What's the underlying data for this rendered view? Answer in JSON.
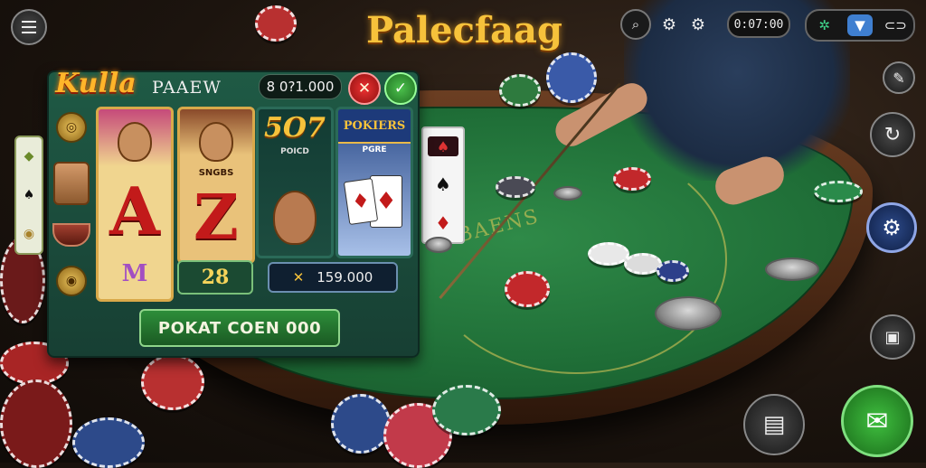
{
  "app": {
    "title": "Palecfaag"
  },
  "hud": {
    "menu_icon": "hamburger-icon",
    "timer": "0:07:00",
    "icons": [
      "search-icon",
      "gear-icon",
      "settings-icon"
    ],
    "right_group": [
      "network-icon",
      "filter-icon",
      "link-icon"
    ],
    "accent_gold": "#f6c23b"
  },
  "slot_panel": {
    "logo_text": "Kulla",
    "game_name": "PAAEW",
    "balance": "8 0?1.000",
    "close_symbol": "✕",
    "confirm_symbol": "✓",
    "reels": [
      {
        "top_label": "",
        "glyph": "A",
        "bottom_label": "M"
      },
      {
        "top_label": "SNGBS",
        "glyph": "Z",
        "bottom_label": ""
      },
      {
        "top_label": "5O7",
        "sub_label": "POICD",
        "glyph": "",
        "bottom_label": ""
      },
      {
        "top_label": "POKIERS",
        "sub_label": "PGRE",
        "glyph": "",
        "bottom_label": ""
      }
    ],
    "reel2_footer": "28",
    "reel34_footer": "159.000",
    "cta_label": "POKAT COEN 000"
  },
  "left_tray": {
    "icons": [
      "gem-icon",
      "spade-icon",
      "chip-icon"
    ]
  },
  "table": {
    "felt_text": "BAENS",
    "card_suits": [
      "♠",
      "♦"
    ]
  },
  "right_controls": {
    "buttons": [
      "wrench-icon",
      "refresh-icon",
      "settings-cog-icon",
      "book-icon",
      "stack-icon",
      "chat-icon"
    ]
  }
}
